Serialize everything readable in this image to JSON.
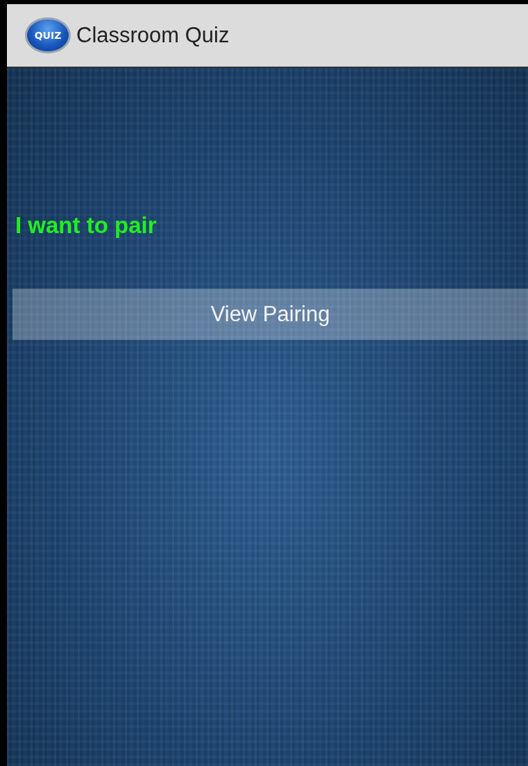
{
  "action_bar": {
    "logo_text": "QUIZ",
    "title": "Classroom Quiz"
  },
  "content": {
    "status_text": "I want to pair",
    "button": "View Pairing"
  }
}
